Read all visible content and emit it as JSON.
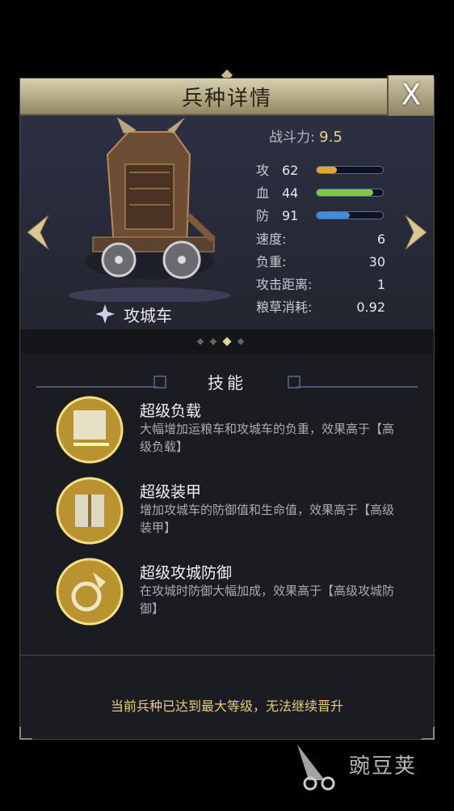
{
  "header": {
    "title": "兵种详情",
    "close_label": "X"
  },
  "unit": {
    "name": "攻城车",
    "power_label": "战斗力:",
    "power_value": "9.5",
    "stats": [
      {
        "label": "攻",
        "value": "62",
        "ratio": 0.3,
        "color": "#e3a43a"
      },
      {
        "label": "血",
        "value": "44",
        "ratio": 0.85,
        "color": "#7fc843"
      },
      {
        "label": "防",
        "value": "91",
        "ratio": 0.5,
        "color": "#3d8de0"
      }
    ],
    "props": [
      {
        "label": "速度:",
        "value": "6"
      },
      {
        "label": "负重:",
        "value": "30"
      },
      {
        "label": "攻击距离:",
        "value": "1"
      },
      {
        "label": "粮草消耗:",
        "value": "0.92"
      }
    ]
  },
  "pager": {
    "count": 4,
    "active_index": 2
  },
  "skills": {
    "title": "技能",
    "items": [
      {
        "name": "超级负载",
        "desc": "大幅增加运粮车和攻城车的负重，效果高于【高级负载】"
      },
      {
        "name": "超级装甲",
        "desc": "增加攻城车的防御值和生命值，效果高于【高级装甲】"
      },
      {
        "name": "超级攻城防御",
        "desc": "在攻城时防御大幅加成，效果高于【高级攻城防御】"
      }
    ]
  },
  "footer": {
    "message": "当前兵种已达到最大等级，无法继续晋升"
  },
  "watermark": {
    "text": "豌豆荚"
  },
  "colors": {
    "gold": "#e3cd7e",
    "panel_bg": "#1b1c21"
  }
}
